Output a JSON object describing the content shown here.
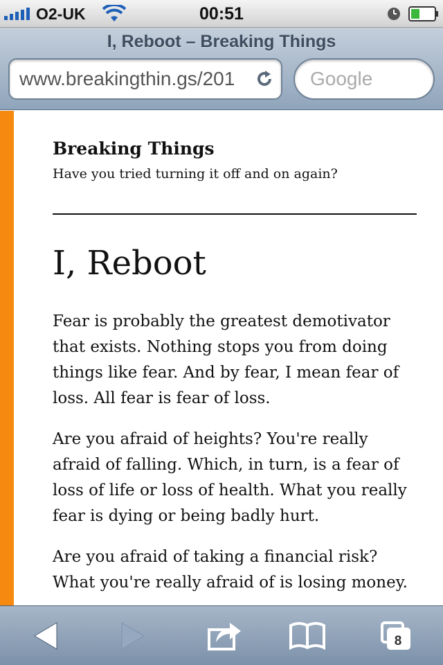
{
  "status_bar": {
    "carrier": "O2-UK",
    "time": "00:51",
    "icons": [
      "signal-icon",
      "wifi-icon",
      "alarm-clock-icon",
      "battery-icon"
    ]
  },
  "browser": {
    "page_title": "I, Reboot – Breaking Things",
    "url": "www.breakingthin.gs/201",
    "search_placeholder": "Google",
    "tab_count": "8",
    "toolbar_icons": [
      "back-icon",
      "forward-icon",
      "share-icon",
      "bookmarks-icon",
      "pages-icon"
    ]
  },
  "site": {
    "title": "Breaking Things",
    "tagline": "Have you tried turning it off and on again?"
  },
  "post": {
    "title": "I, Reboot",
    "paragraphs": [
      "Fear is probably the greatest demotivator that exists. Nothing stops you from doing things like fear. And by fear, I mean fear of loss. All fear is fear of loss.",
      "Are you afraid of heights? You're really afraid of falling. Which, in turn, is a fear of loss of life or loss of health. What you really fear is dying or being badly hurt.",
      "Are you afraid of taking a financial risk? What you're really afraid of is losing money."
    ]
  },
  "colors": {
    "accent": "#f68a10",
    "toolbar": "#8fa4bb"
  }
}
